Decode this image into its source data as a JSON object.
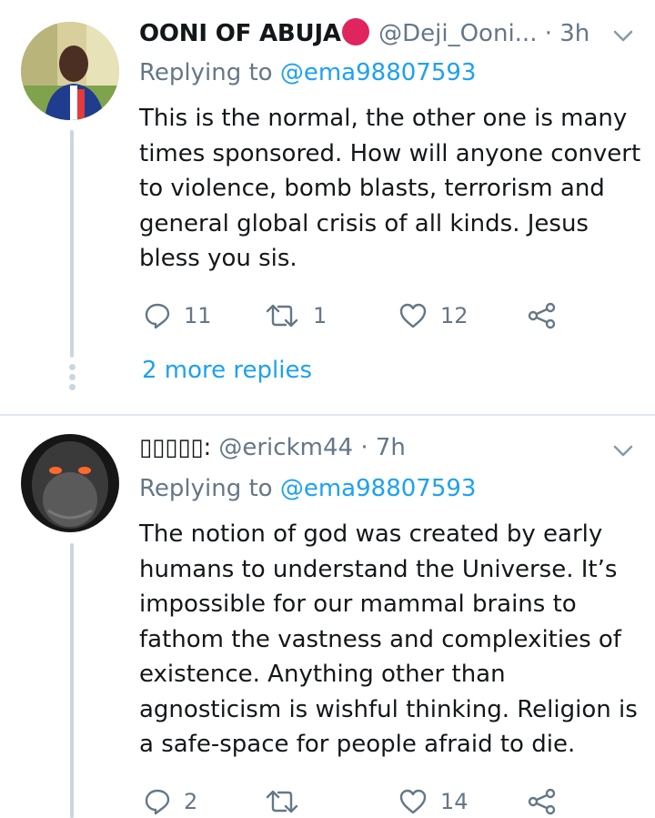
{
  "tweets": [
    {
      "author_name": "OONI OF ABUJA",
      "handle": "@Deji_Ooni...",
      "time": "· 3h",
      "replying_prefix": "Replying to",
      "replying_to": "@ema98807593",
      "text": "This is the normal, the other one is many times sponsored. How will anyone convert to violence, bomb blasts, terrorism and general global crisis of all kinds. Jesus bless you sis.",
      "replies": "11",
      "retweets": "1",
      "likes": "12",
      "more_replies": "2 more replies"
    },
    {
      "author_name": "▯▯▯▯▯:",
      "handle": "@erickm44",
      "time": "· 7h",
      "replying_prefix": "Replying to",
      "replying_to": "@ema98807593",
      "text": "The notion of god was created by early humans to understand the Universe. It’s impossible for our mammal brains to fathom the vastness and complexities of existence. Anything other than agnosticism is wishful thinking. Religion is a safe-space for people afraid to die.",
      "replies": "2",
      "retweets": "",
      "likes": "14"
    }
  ],
  "colors": {
    "accent": "#1da1f2",
    "secondary": "#657786",
    "badge": "#e0245e",
    "thread_line": "#ccd6dd"
  },
  "icons": [
    "reply-icon",
    "retweet-icon",
    "like-icon",
    "share-icon",
    "chevron-down-icon"
  ]
}
